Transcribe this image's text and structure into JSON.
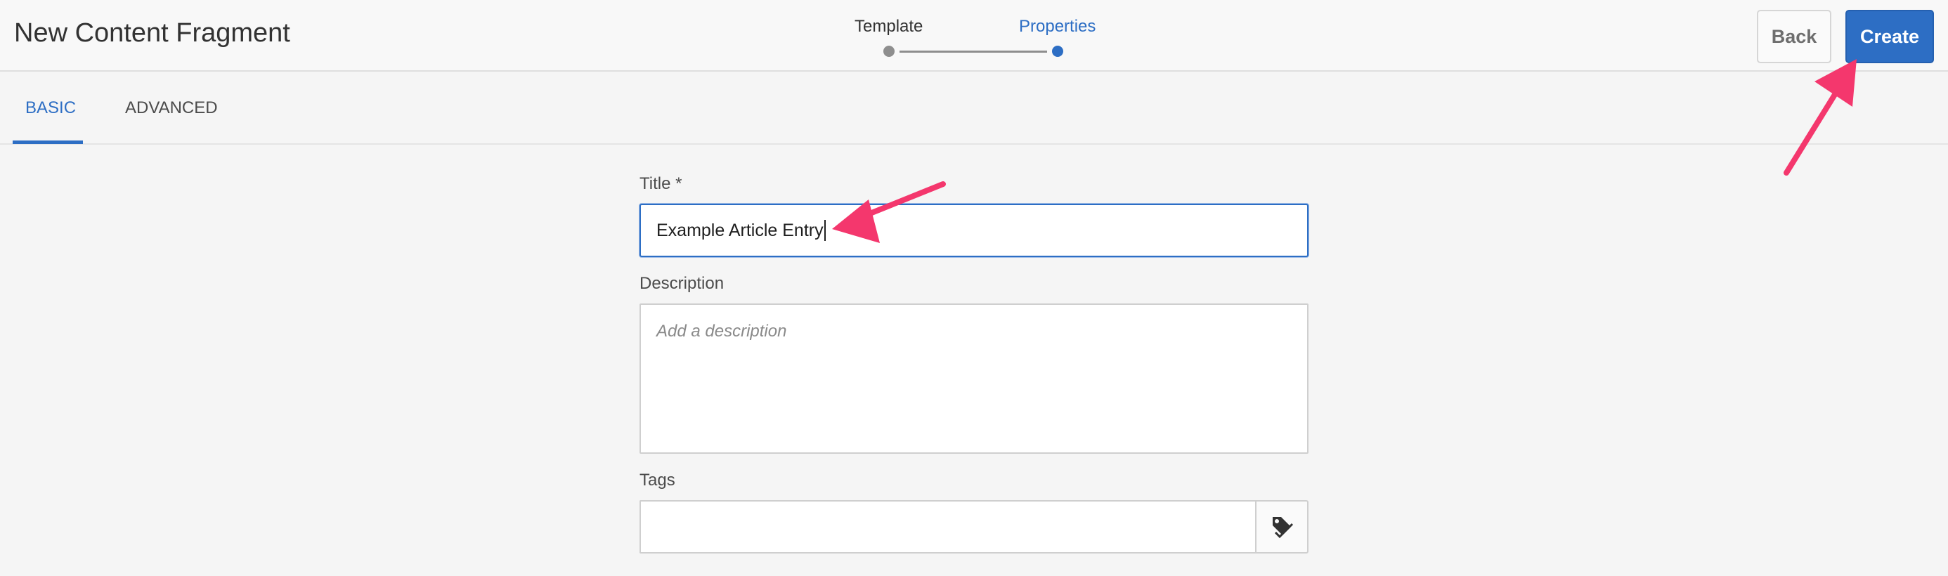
{
  "header": {
    "title": "New Content Fragment",
    "wizard": {
      "steps": [
        {
          "label": "Template",
          "state": "done"
        },
        {
          "label": "Properties",
          "state": "current"
        }
      ]
    },
    "back_label": "Back",
    "create_label": "Create"
  },
  "tabs": [
    {
      "label": "BASIC",
      "active": true
    },
    {
      "label": "ADVANCED",
      "active": false
    }
  ],
  "form": {
    "title": {
      "label": "Title *",
      "value": "Example Article Entry"
    },
    "description": {
      "label": "Description",
      "placeholder": "Add a description",
      "value": ""
    },
    "tags": {
      "label": "Tags",
      "value": "",
      "picker_icon": "tag-icon"
    }
  },
  "colors": {
    "accent": "#2d6ec4",
    "annotation_arrow": "#f4376d"
  }
}
